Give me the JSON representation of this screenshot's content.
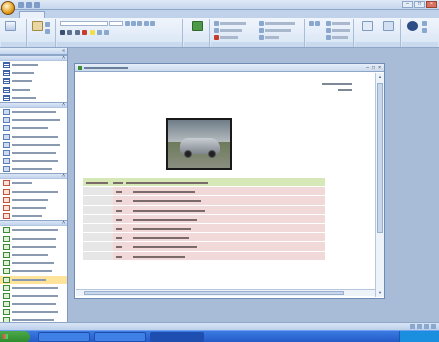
{
  "app": {
    "title": "",
    "minimize": "–",
    "maximize": "□",
    "close": "×"
  },
  "tabs": [
    {
      "label": "",
      "active": true
    },
    {
      "label": "",
      "active": false
    },
    {
      "label": "",
      "active": false
    },
    {
      "label": "",
      "active": false
    }
  ],
  "ribbon": {
    "groups": [
      {
        "label": "",
        "buttons": [
          ""
        ]
      },
      {
        "label": "",
        "buttons": []
      },
      {
        "label": "",
        "buttons": []
      },
      {
        "label": "",
        "buttons": [
          ""
        ]
      },
      {
        "label": "",
        "buttons": []
      },
      {
        "label": "",
        "buttons": [
          "",
          ""
        ]
      },
      {
        "label": "",
        "buttons": [
          ""
        ]
      },
      {
        "label": "",
        "buttons": [
          ""
        ]
      }
    ]
  },
  "nav_pane": {
    "title": "",
    "groups": [
      {
        "title": "",
        "type": "table",
        "items": [
          "",
          "",
          "",
          "",
          ""
        ]
      },
      {
        "title": "",
        "type": "query",
        "items": [
          "",
          "",
          "",
          "",
          "",
          "",
          "",
          ""
        ]
      },
      {
        "title": "",
        "type": "form",
        "items": [
          "",
          "",
          "",
          "",
          ""
        ]
      },
      {
        "title": "",
        "type": "report",
        "items": [
          "",
          "",
          "",
          "",
          "",
          "",
          "",
          "",
          "",
          "",
          "",
          ""
        ],
        "selected": 6
      }
    ]
  },
  "report_window": {
    "title": "",
    "date": "",
    "time": "",
    "photo_alt": "car-photo",
    "table": {
      "columns": [
        "",
        "",
        ""
      ],
      "rows": [
        [
          "",
          "",
          ""
        ],
        [
          "",
          "",
          ""
        ],
        [
          "",
          "",
          ""
        ],
        [
          "",
          "",
          ""
        ],
        [
          "",
          "",
          ""
        ],
        [
          "",
          "",
          ""
        ],
        [
          "",
          "",
          ""
        ],
        [
          "",
          "",
          ""
        ]
      ]
    }
  },
  "status": {
    "left": ""
  },
  "taskbar": {
    "start": "",
    "buttons": [
      {
        "label": "",
        "active": false
      },
      {
        "label": "",
        "active": false
      },
      {
        "label": "",
        "active": true
      }
    ],
    "clock": ""
  },
  "colors": {
    "header_row": "#d5e8b6",
    "data_row": "#f2d9d9",
    "selected_item": "#ffe39a",
    "taskbar": "#245bc7"
  }
}
